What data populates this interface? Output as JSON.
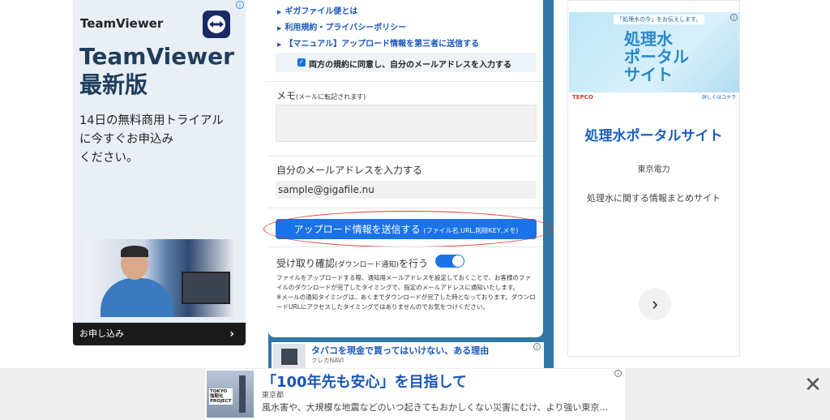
{
  "left_ad": {
    "brand": "TeamViewer",
    "headline": "TeamViewer\n最新版",
    "body": "14日の無料商用トライアル\nに今すぐお申込み\nください。",
    "cta": "お申し込み",
    "cta_chevron": "›",
    "adchoice": "i"
  },
  "main": {
    "links": [
      "ギガファイル便とは",
      "利用規約・プライバシーポリシー",
      "【マニュアル】アップロード情報を第三者に送信する"
    ],
    "link_marker": "▶",
    "agree_label": "両方の規約に同意し、自分のメールアドレスを入力する",
    "memo_label": "メモ",
    "memo_note": "(メールに転記されます)",
    "email_label": "自分のメールアドレスを入力する",
    "email_value": "sample@gigafile.nu",
    "send_button": "アップロード情報を送信する",
    "send_button_note": "(ファイル名,URL,削除KEY,メモ)",
    "receipt_label": "受け取り確認",
    "receipt_note": "(ダウンロード通知)",
    "receipt_suffix": "を行う",
    "description_1": "ファイルをアップロードする際、通知用メールアドレスを設定しておくことで、お客様のファイルのダウンロードが完了したタイミングで、指定のメールアドレスに通知いたします。",
    "description_2": "※メールの通知タイミングは、あくまでダウンロードが完了した時となっております。ダウンロードURLにアクセスしたタイミングではありませんのでお気をつけください。"
  },
  "sub_ad": {
    "title": "タバコを現金で買ってはいけない、ある理由",
    "source": "クレカNAVI"
  },
  "right_ad": {
    "tagline": "「処理水の今」をお伝えします。",
    "banner_text": "処理水\nポータル\nサイト",
    "tepco": "TEPCO",
    "more": "詳しくはコチラ",
    "title": "処理水ポータルサイト",
    "source": "東京電力",
    "description": "処理水に関する情報まとめサイト",
    "next": "›"
  },
  "bottom_ad": {
    "thumb_text": "TOKYO\n強靭化\nPROJECT",
    "headline": "「100年先も安心」を目指して",
    "source": "東京都",
    "description": "風水害や、大規模な地震などのいつ起きてもおかしくない災害にむけ、より強い東京…",
    "close": "✕"
  },
  "colors": {
    "page_accent": "#3277a8",
    "button_blue": "#1a73e8",
    "link_blue": "#1a56b8",
    "highlight_ring": "#e03a28"
  }
}
